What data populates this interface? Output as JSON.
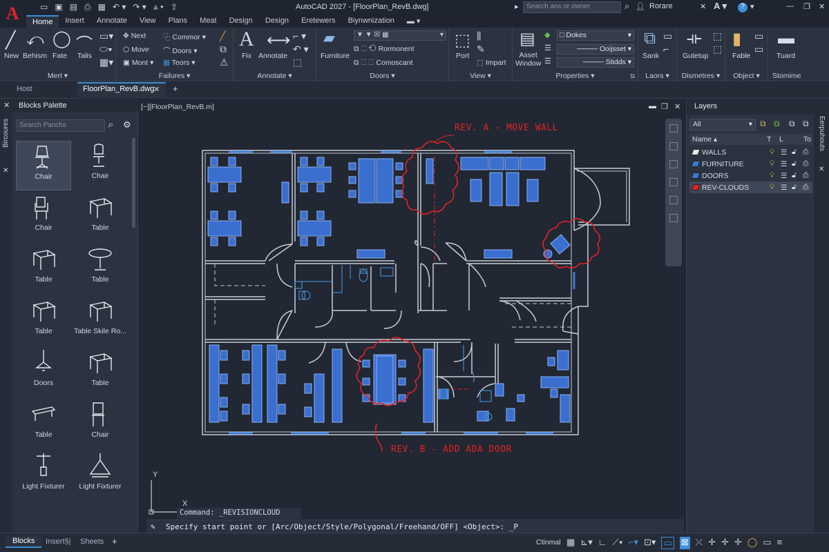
{
  "app": {
    "title": "AutoCAD 2027 - [FloorPlan_RevB.dwg]",
    "logo": "A"
  },
  "topbar": {
    "search_placeholder": "Search ans or owner",
    "user": "Rorare",
    "accent": "#3d8fd8"
  },
  "ribbon_tabs": [
    "Home",
    "Insert",
    "Annotate",
    "View",
    "Plans",
    "Meat",
    "Design",
    "Design",
    "Eretewers",
    "Biynwnization"
  ],
  "ribbon": {
    "mert": {
      "label": "Mert",
      "new": "New",
      "behism": "Behism",
      "fate": "Fate",
      "talis": "Talis"
    },
    "failures": {
      "label": "Failures",
      "next": "Next",
      "move": "Move",
      "mont": "Mont",
      "commor": "Commor",
      "doors": "Doors",
      "teors": "Teors"
    },
    "annotate": {
      "label": "Annotate",
      "fix": "Fix",
      "annotate": "Annotate"
    },
    "doors": {
      "label": "Doors",
      "furniture": "Furniture",
      "rormonent": "Rormonent",
      "comoscant": "Comoscant"
    },
    "view": {
      "label": "View",
      "port": "Port",
      "impart": "Impart"
    },
    "properties": {
      "label": "Properties",
      "asset_window": "Asset\nWindow",
      "dokes": "Dokes",
      "ooijsset": "Ooijsset",
      "stidds": "Stidds"
    },
    "laors": {
      "label": "Laors",
      "sank": "Sank"
    },
    "dismetres": {
      "label": "Dismetres",
      "gutetup": "Gutetup"
    },
    "object": {
      "label": "Object",
      "fable": "Fable"
    },
    "stomime": {
      "label": "Stomime",
      "tuard": "Tuard"
    }
  },
  "doc_tabs": {
    "host": "Host",
    "active": "FloorPlan_RevB.dwg"
  },
  "blocks_palette": {
    "title": "Blocks Palette",
    "side_label": "Bircoures",
    "search_placeholder": "Search Panchs",
    "items": [
      {
        "label": "Chair",
        "icon": "office-chair-icon"
      },
      {
        "label": "Chair",
        "icon": "swivel-chair-icon"
      },
      {
        "label": "Chair",
        "icon": "armchair-icon"
      },
      {
        "label": "Table",
        "icon": "table-icon"
      },
      {
        "label": "Table",
        "icon": "table-icon"
      },
      {
        "label": "Table",
        "icon": "round-table-icon"
      },
      {
        "label": "Table",
        "icon": "table-icon"
      },
      {
        "label": "Table Skile Ro...",
        "icon": "table-icon"
      },
      {
        "label": "Doors",
        "icon": "pendant-lamp-icon"
      },
      {
        "label": "Table",
        "icon": "table-icon"
      },
      {
        "label": "Table",
        "icon": "bench-icon"
      },
      {
        "label": "Chair",
        "icon": "chair-icon"
      },
      {
        "label": "Light Fixturer",
        "icon": "pendant-light-icon"
      },
      {
        "label": "Light Fixturer",
        "icon": "ceiling-light-icon"
      }
    ],
    "bottom_tabs": [
      "Blocks",
      "Insert§|",
      "Sheets"
    ]
  },
  "viewport": {
    "label": "[−][FloorPlan_RevB.m]",
    "annotations": [
      "REV. A - MOVE WALL",
      "REV. B - ADD ADA DOOR"
    ],
    "ucs": {
      "x": "X",
      "y": "Y"
    }
  },
  "layers": {
    "title": "Layers",
    "side_label": "Eerpuhouts",
    "filter": "All",
    "columns": [
      "Name",
      "T",
      "L",
      "To"
    ],
    "rows": [
      {
        "name": "WALLS",
        "color": "#e8e8e8"
      },
      {
        "name": "FURNITURE",
        "color": "#3a7bd5"
      },
      {
        "name": "DOORS",
        "color": "#3a7bd5"
      },
      {
        "name": "REV-CLOUDS",
        "color": "#e02424",
        "selected": true
      }
    ]
  },
  "command": {
    "history": "Command: _REVISIONCLOUD",
    "prompt": "Specify start point or [Arc/Object/Style/Polygonal/Freehand/OFF] <Object>: _P"
  },
  "status": {
    "model": "Ctinmal"
  }
}
